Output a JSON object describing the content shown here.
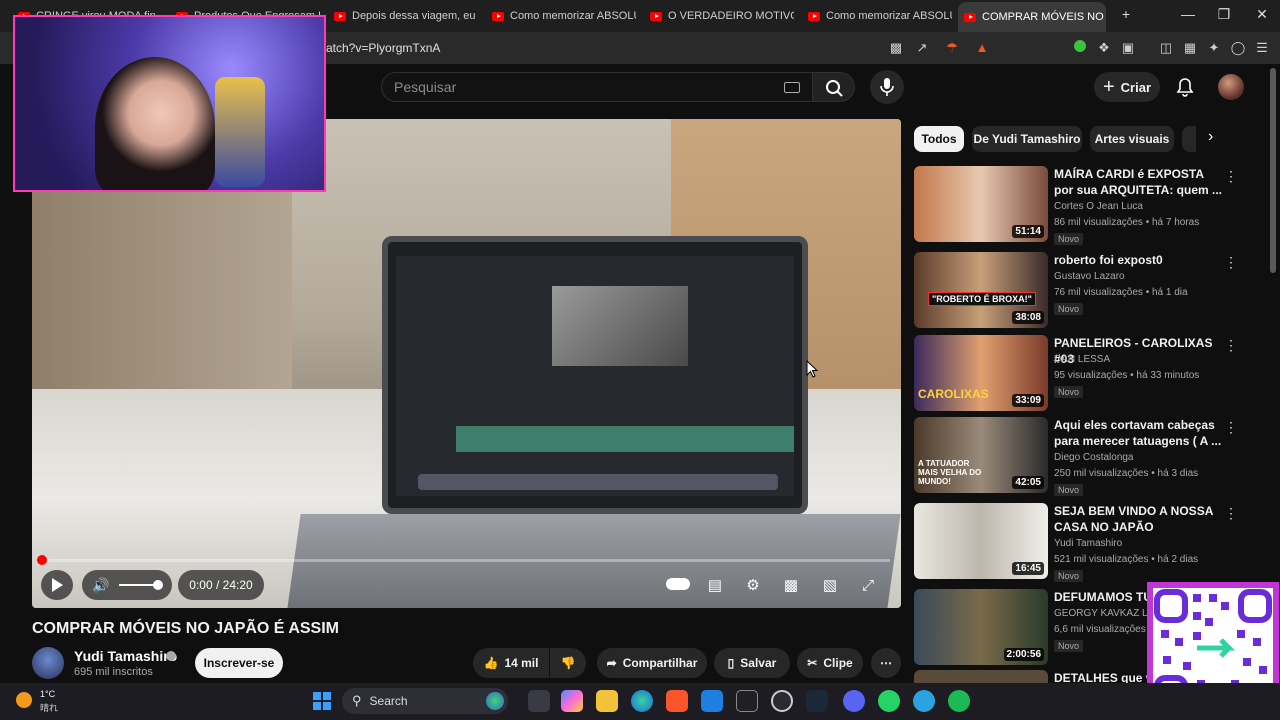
{
  "browser": {
    "tabs": [
      {
        "label": "CRINGE virou MODA fin"
      },
      {
        "label": "Produtos Que Engrosam P"
      },
      {
        "label": "Depois dessa viagem, eu pr"
      },
      {
        "label": "Como memorizar ABSOLUTA"
      },
      {
        "label": "O VERDADEIRO MOTIVO DE"
      },
      {
        "label": "Como memorizar ABSOLUTA"
      },
      {
        "label": "COMPRAR MÓVEIS NO JA",
        "active": true
      }
    ],
    "url": "atch?v=PlyorgmTxnA",
    "new_tab": "+",
    "close_tab": "×"
  },
  "youtube": {
    "search_placeholder": "Pesquisar",
    "create_label": "Criar"
  },
  "player": {
    "time": "0:00 / 24:20",
    "progress": 0
  },
  "video": {
    "title": "COMPRAR MÓVEIS NO JAPÃO É ASSIM",
    "channel": "Yudi Tamashiro",
    "subscribers": "695 mil inscritos",
    "subscribe_label": "Inscrever-se",
    "likes": "14 mil",
    "share_label": "Compartilhar",
    "save_label": "Salvar",
    "clip_label": "Clipe"
  },
  "chips": [
    "Todos",
    "De Yudi Tamashiro",
    "Artes visuais"
  ],
  "recommendations": [
    {
      "title": "MAÍRA CARDI é EXPOSTA por sua ARQUITETA: quem ...",
      "channel": "Cortes O Jean Luca",
      "meta": "86 mil visualizações • há 7 horas",
      "duration": "51:14",
      "badge": "Novo"
    },
    {
      "title": "roberto foi expost0",
      "channel": "Gustavo Lazaro",
      "meta": "76 mil visualizações • há 1 dia",
      "duration": "38:08",
      "badge": "Novo",
      "thumb_text": "\"ROBERTO É BROXA!\""
    },
    {
      "title": "PANELEIROS - CAROLIXAS #03",
      "channel": "DAN LESSA",
      "meta": "95 visualizações • há 33 minutos",
      "duration": "33:09",
      "badge": "Novo",
      "thumb_text": "CAROLIXAS"
    },
    {
      "title": "Aqui eles cortavam cabeças para merecer tatuagens ( A ...",
      "channel": "Diego Costalonga",
      "meta": "250 mil visualizações • há 3 dias",
      "duration": "42:05",
      "badge": "Novo",
      "thumb_text": "A TATUADOR MAIS VELHA DO MUNDO!"
    },
    {
      "title": "SEJA BEM VINDO A NOSSA CASA NO JAPÃO",
      "channel": "Yudi Tamashiro",
      "meta": "521 mil visualizações • há 2 dias",
      "duration": "16:45",
      "badge": "Novo"
    },
    {
      "title": "DEFUMAMOS TUD",
      "channel": "GEORGY KAVKAZ Life",
      "meta": "6,6 mil visualizações",
      "duration": "2:00:56",
      "badge": "Novo"
    },
    {
      "title": "DETALHES que vo",
      "channel": "",
      "meta": "",
      "duration": "",
      "badge": ""
    }
  ],
  "taskbar": {
    "weather_temp": "1°C",
    "weather_desc": "晴れ",
    "search_label": "Search"
  },
  "colors": {
    "accent": "#ff0000",
    "background": "#0f0f0f",
    "webcam_border": "#ff3ab5",
    "qr_border": "#c236d8"
  }
}
